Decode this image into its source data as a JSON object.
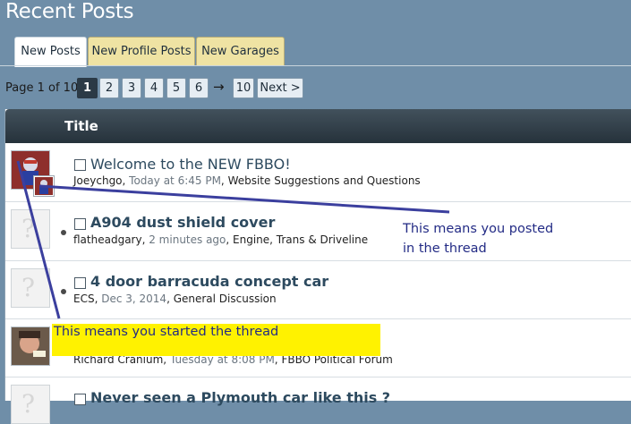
{
  "page": {
    "title": "Recent Posts"
  },
  "tabs": [
    {
      "label": "New Posts",
      "active": true
    },
    {
      "label": "New Profile Posts",
      "active": false
    },
    {
      "label": "New Garages",
      "active": false
    }
  ],
  "pagination": {
    "label": "Page 1 of 10",
    "current": "1",
    "pages": [
      "1",
      "2",
      "3",
      "4",
      "5",
      "6"
    ],
    "arrow": "→",
    "last": "10",
    "next": "Next >"
  },
  "list": {
    "header": "Title",
    "threads": [
      {
        "title": "Welcome to the NEW FBBO!",
        "author": "Joeychgo",
        "time": "Today at 6:45 PM",
        "forum": "Website Suggestions and Questions",
        "bold": false,
        "dot": false
      },
      {
        "title": "A904 dust shield cover",
        "author": "flatheadgary",
        "time": "2 minutes ago",
        "forum": "Engine, Trans & Driveline",
        "bold": true,
        "dot": true
      },
      {
        "title": "4 door barracuda concept car",
        "author": "ECS",
        "time": "Dec 3, 2014",
        "forum": "General Discussion",
        "bold": true,
        "dot": true
      },
      {
        "title": "",
        "author": "Richard Cranium",
        "time": "Tuesday at 8:08 PM",
        "forum": "FBBO Political Forum",
        "bold": false,
        "dot": false
      },
      {
        "title": "Never seen a Plymouth car like this ?",
        "author": "",
        "time": "",
        "forum": "",
        "bold": true,
        "dot": false
      }
    ]
  },
  "annotations": {
    "posted": "This means you posted\nin the thread",
    "started": "This means you started the thread",
    "arrow_color": "#3b3f9e",
    "highlight_color": "#fff200"
  }
}
